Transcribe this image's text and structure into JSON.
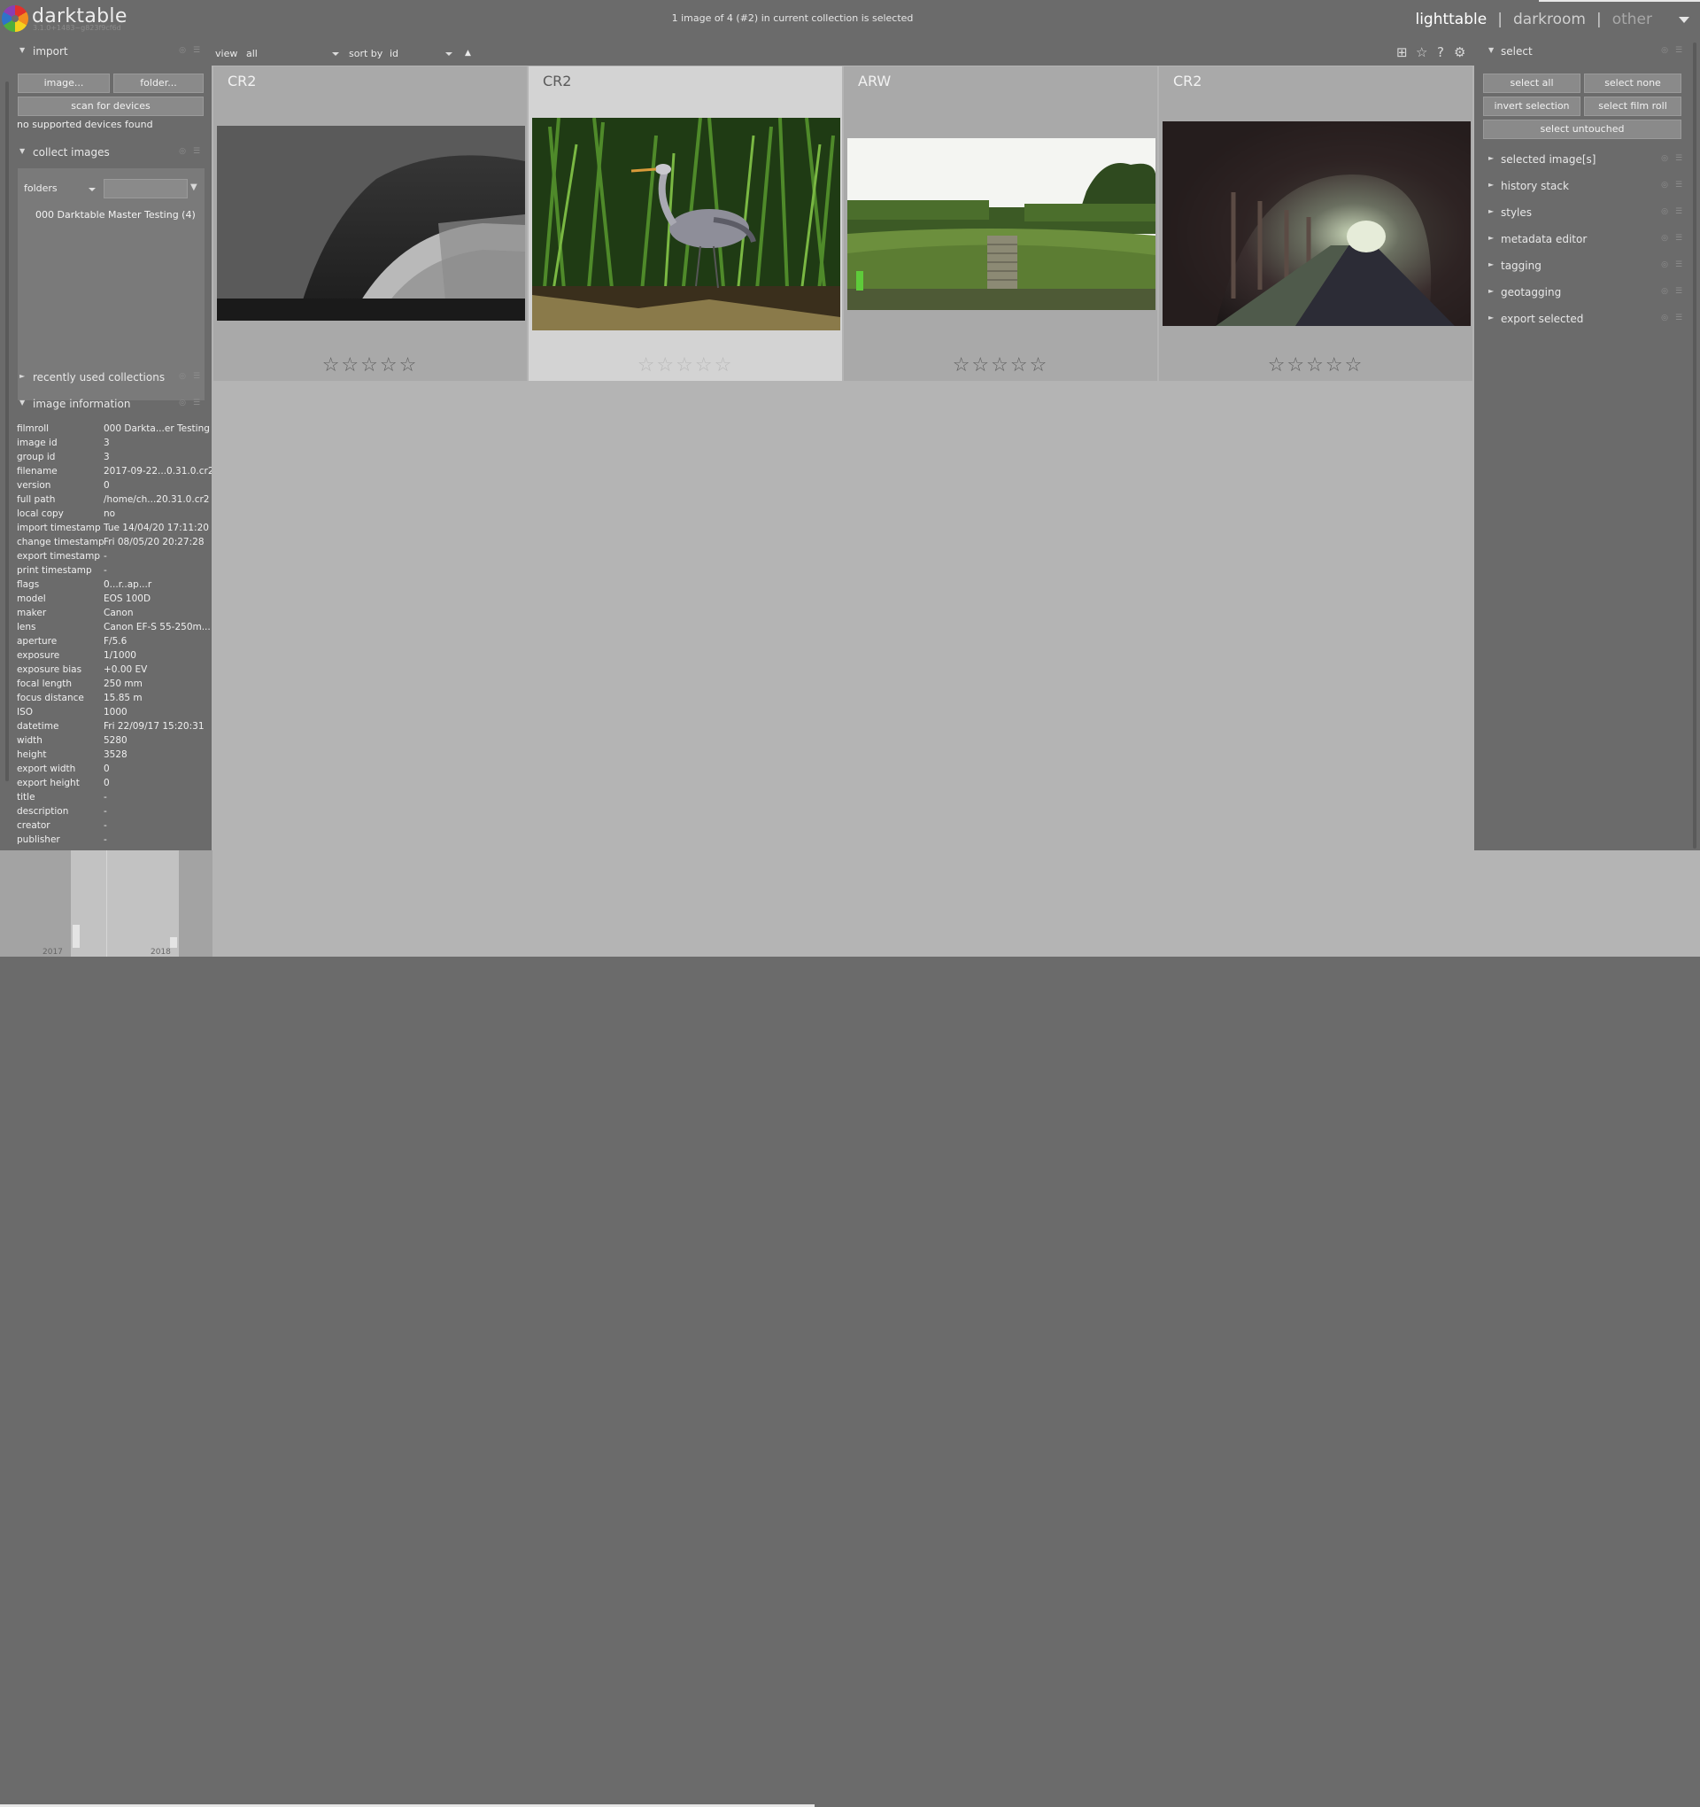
{
  "header": {
    "app_name": "darktable",
    "app_version": "3.1.0+1483~g823f9cf6d",
    "status": "1 image of 4 (#2) in current collection is selected",
    "views": [
      "lighttable",
      "darkroom",
      "other"
    ],
    "separator": "|"
  },
  "left": {
    "import": {
      "title": "import",
      "image_button": "image...",
      "folder_button": "folder...",
      "scan_button": "scan for devices",
      "no_devices": "no supported devices found"
    },
    "collect": {
      "title": "collect images",
      "mode": "folders",
      "item": "000 Darktable Master Testing (4)"
    },
    "recent": {
      "title": "recently used collections"
    },
    "image_info": {
      "title": "image information",
      "rows": [
        {
          "key": "filmroll",
          "value": "000 Darkta...er Testing"
        },
        {
          "key": "image id",
          "value": "3"
        },
        {
          "key": "group id",
          "value": "3"
        },
        {
          "key": "filename",
          "value": "2017-09-22...0.31.0.cr2"
        },
        {
          "key": "version",
          "value": "0"
        },
        {
          "key": "full path",
          "value": "/home/ch...20.31.0.cr2"
        },
        {
          "key": "local copy",
          "value": "no"
        },
        {
          "key": "import timestamp",
          "value": "Tue 14/04/20 17:11:20"
        },
        {
          "key": "change timestamp",
          "value": "Fri 08/05/20 20:27:28"
        },
        {
          "key": "export timestamp",
          "value": "-"
        },
        {
          "key": "print timestamp",
          "value": "-"
        },
        {
          "key": "flags",
          "value": "0...r..ap...r"
        },
        {
          "key": "model",
          "value": "EOS 100D"
        },
        {
          "key": "maker",
          "value": "Canon"
        },
        {
          "key": "lens",
          "value": "Canon EF-S 55-250m..."
        },
        {
          "key": "aperture",
          "value": "F/5.6"
        },
        {
          "key": "exposure",
          "value": "1/1000"
        },
        {
          "key": "exposure bias",
          "value": "+0.00 EV"
        },
        {
          "key": "focal length",
          "value": "250 mm"
        },
        {
          "key": "focus distance",
          "value": "15.85 m"
        },
        {
          "key": "ISO",
          "value": "1000"
        },
        {
          "key": "datetime",
          "value": "Fri 22/09/17 15:20:31"
        },
        {
          "key": "width",
          "value": "5280"
        },
        {
          "key": "height",
          "value": "3528"
        },
        {
          "key": "export width",
          "value": "0"
        },
        {
          "key": "export height",
          "value": "0"
        },
        {
          "key": "title",
          "value": "-"
        },
        {
          "key": "description",
          "value": "-"
        },
        {
          "key": "creator",
          "value": "-"
        },
        {
          "key": "publisher",
          "value": "-"
        }
      ]
    }
  },
  "toolbar": {
    "view_label": "view",
    "view_value": "all",
    "sort_label": "sort by",
    "sort_value": "id",
    "sort_direction_icon": "triangle-up-icon"
  },
  "thumbnails": [
    {
      "ext": "CR2",
      "subject": "stone bridge arch (black and white)",
      "selected": false,
      "rating_max": 5
    },
    {
      "ext": "CR2",
      "subject": "grey heron among reeds",
      "selected": true,
      "rating_max": 5
    },
    {
      "ext": "ARW",
      "subject": "garden lawn with steps and hedges",
      "selected": false,
      "rating_max": 5
    },
    {
      "ext": "CR2",
      "subject": "canal tunnel with towpath",
      "selected": false,
      "rating_max": 5
    }
  ],
  "right": {
    "select": {
      "title": "select",
      "select_all": "select all",
      "select_none": "select none",
      "invert": "invert selection",
      "film_roll": "select film roll",
      "untouched": "select untouched"
    },
    "modules": [
      "selected image[s]",
      "history stack",
      "styles",
      "metadata editor",
      "tagging",
      "geotagging",
      "export selected"
    ]
  },
  "timeline": {
    "years": [
      "2017",
      "2018"
    ]
  },
  "colors": {
    "panel_bg": "#6b6b6b",
    "center_bg": "#b4b4b4",
    "thumb_bg": "#a9a9a9",
    "thumb_selected_bg": "#d3d3d3"
  }
}
